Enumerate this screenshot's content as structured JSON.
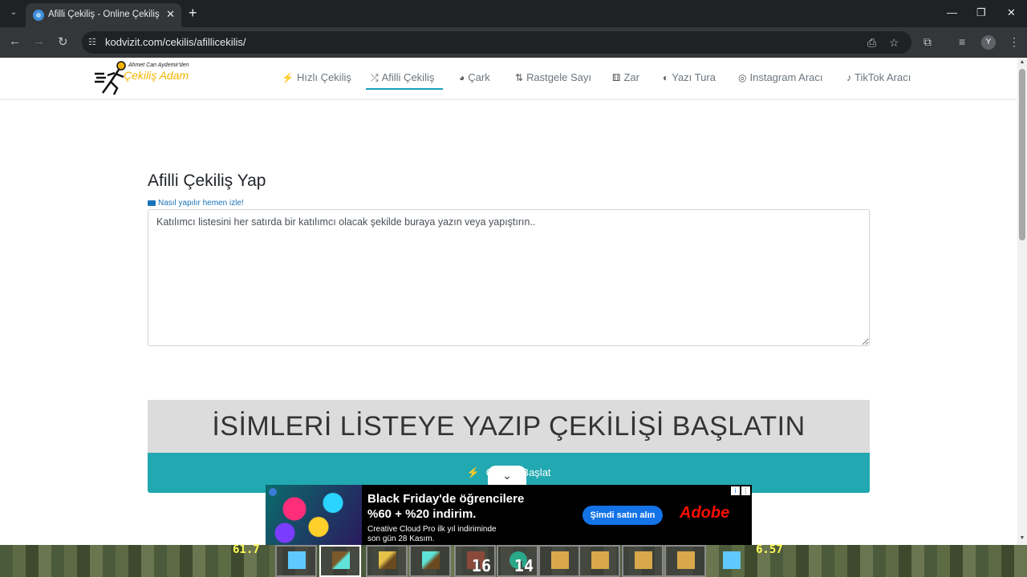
{
  "browser": {
    "tab_title": "Afilli Çekiliş - Online Çekiliş - H",
    "url": "kodvizit.com/cekilis/afillicekilis/",
    "profile_initial": "Y"
  },
  "site": {
    "logo_small": "Ahmet Can Aydemir'den",
    "logo_big": "Çekiliş Adam",
    "nav": [
      {
        "label": "Hızlı Çekiliş",
        "icon": "bolt-icon",
        "glyph": "⚡"
      },
      {
        "label": "Afilli Çekiliş",
        "icon": "random-icon",
        "glyph": "⤮"
      },
      {
        "label": "Çark",
        "icon": "pie-chart-icon",
        "glyph": "◕"
      },
      {
        "label": "Rastgele Sayı",
        "icon": "sort-numeric-icon",
        "glyph": "⇅"
      },
      {
        "label": "Zar",
        "icon": "dice-icon",
        "glyph": "⚅"
      },
      {
        "label": "Yazı Tura",
        "icon": "coin-icon",
        "glyph": "◐"
      },
      {
        "label": "Instagram Aracı",
        "icon": "instagram-icon",
        "glyph": "◎"
      },
      {
        "label": "TikTok Aracı",
        "icon": "tiktok-icon",
        "glyph": "♪"
      }
    ]
  },
  "main": {
    "heading": "Afilli Çekiliş Yap",
    "how_to_link": "Nasıl yapılır hemen izle!",
    "textarea_placeholder": "Katılımcı listesini her satırda bir katılımcı olacak şekilde buraya yazın veya yapıştırın..",
    "banner_text": "İSİMLERİ LİSTEYE YAZIP ÇEKİLİŞİ BAŞLATIN",
    "start_button": "Çekilişi Başlat"
  },
  "ad": {
    "title_line1": "Black Friday'de öğrencilere",
    "title_line2": "%60 + %20 indirim.",
    "sub_line1": "Creative Cloud Pro ilk yıl indiriminde",
    "sub_line2": "son gün 28 Kasım.",
    "cta": "Şimdi satın alın",
    "brand": "Adobe"
  },
  "game_hud": {
    "left_value": "61.7",
    "right_value": "6.57",
    "slot_counts": [
      "",
      "",
      "",
      "",
      "16",
      "14",
      "",
      "",
      "",
      ""
    ]
  }
}
